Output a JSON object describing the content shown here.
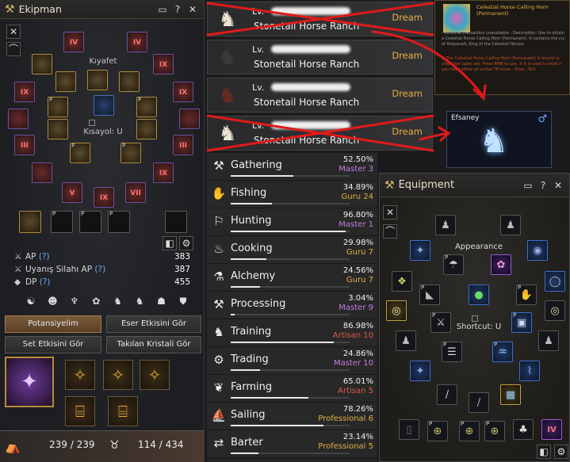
{
  "ekipman": {
    "title": "Ekipman",
    "appearance_label": "Kıyafet",
    "shortcut_label": "Kısayol: U",
    "stats": [
      {
        "label": "AP",
        "q": "(?)",
        "value": "383"
      },
      {
        "label": "Uyanış Silahı AP",
        "q": "(?)",
        "value": "387"
      },
      {
        "label": "DP",
        "q": "(?)",
        "value": "455"
      }
    ],
    "buttons": {
      "potential": "Potansiyelim",
      "artifact": "Eser Etkisini Gör",
      "set_effect": "Set Etkisini Gör",
      "crystal": "Takılan Kristali Gör"
    },
    "roman": [
      "IV",
      "IV",
      "IX",
      "IX",
      "IX",
      "IX",
      "III",
      "III",
      "IX",
      "IX",
      "V",
      "IX",
      "VII"
    ]
  },
  "bottombar": {
    "hp": "239 / 239",
    "weight": "114 / 434"
  },
  "horses": [
    {
      "lv": "Lv.",
      "ranch": "Stonetail Horse Ranch",
      "rank": "Dream",
      "color": "#e9e3cf",
      "crossed": true
    },
    {
      "lv": "Lv.",
      "ranch": "Stonetail Horse Ranch",
      "rank": "Dream",
      "color": "#1a1a1a",
      "crossed": false
    },
    {
      "lv": "Lv.",
      "ranch": "Stonetail Horse Ranch",
      "rank": "Dream",
      "color": "#5a2420",
      "crossed": false
    },
    {
      "lv": "Lv.",
      "ranch": "Stonetail Horse Ranch",
      "rank": "Dream",
      "color": "#ece6d6",
      "crossed": true
    }
  ],
  "tooltip": {
    "title": "Celestial Horse Calling Horn (Permanent)",
    "desc": "- Personal transaction unavailable - Description: Use to obtain a Celestial Horse Calling Horn (Permanent). It contains the cry of Arduanatt, King of the Celestial Horses.",
    "warn": "※ The Celestial Horse Calling Horn (Permanent) is bound to character upon use. Press RMB to use. ※ It is used to level if you have either an active T8 horse - Price : N/A"
  },
  "efsaney": {
    "name": "Efsaney",
    "sex": "♂"
  },
  "skills": [
    {
      "name": "Gathering",
      "pct": "52.50%",
      "level": "Master 3",
      "color": "#c77be0",
      "fill": 0.525
    },
    {
      "name": "Fishing",
      "pct": "34.89%",
      "level": "Guru 24",
      "color": "#e0b040",
      "fill": 0.3489
    },
    {
      "name": "Hunting",
      "pct": "96.80%",
      "level": "Master 1",
      "color": "#c77be0",
      "fill": 0.968
    },
    {
      "name": "Cooking",
      "pct": "29.98%",
      "level": "Guru 7",
      "color": "#e0b040",
      "fill": 0.2998
    },
    {
      "name": "Alchemy",
      "pct": "24.56%",
      "level": "Guru 7",
      "color": "#e0b040",
      "fill": 0.2456
    },
    {
      "name": "Processing",
      "pct": "3.04%",
      "level": "Master 9",
      "color": "#c77be0",
      "fill": 0.0304
    },
    {
      "name": "Training",
      "pct": "86.98%",
      "level": "Artisan 10",
      "color": "#e05a4a",
      "fill": 0.8698
    },
    {
      "name": "Trading",
      "pct": "24.86%",
      "level": "Master 10",
      "color": "#c77be0",
      "fill": 0.2486
    },
    {
      "name": "Farming",
      "pct": "65.01%",
      "level": "Artisan 5",
      "color": "#e05a4a",
      "fill": 0.6501
    },
    {
      "name": "Sailing",
      "pct": "78.26%",
      "level": "Professional 6",
      "color": "#e0b040",
      "fill": 0.7826
    },
    {
      "name": "Barter",
      "pct": "23.14%",
      "level": "Professional 5",
      "color": "#e0b040",
      "fill": 0.2314
    }
  ],
  "equipment": {
    "title": "Equipment",
    "appearance_label": "Appearance",
    "shortcut_label": "Shortcut: U",
    "roman": "IV"
  }
}
